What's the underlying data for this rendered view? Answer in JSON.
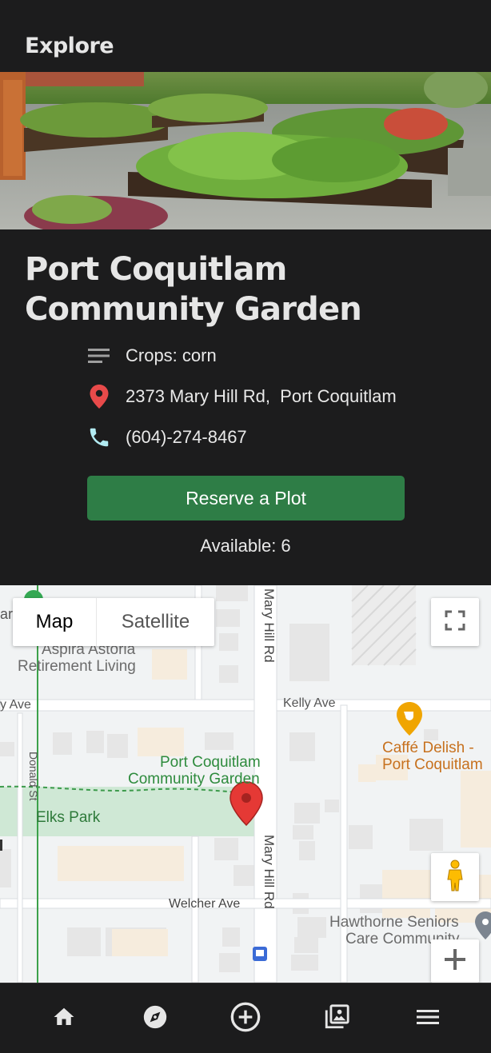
{
  "header": {
    "title": "Explore"
  },
  "garden": {
    "name": "Port Coquitlam Community Garden",
    "crops": "Crops: corn",
    "address": "2373 Mary Hill Rd,  Port Coquitlam",
    "phone": "(604)-274-8467",
    "reserve_label": "Reserve a Plot",
    "available": "Available: 6"
  },
  "map": {
    "type_map": "Map",
    "type_satellite": "Satellite",
    "labels": {
      "aspira": "Aspira Astoria",
      "retirement": "Retirement Living",
      "ar": "ar",
      "kelly_left": "y Ave",
      "kelly_right": "Kelly Ave",
      "donald": "Donald St",
      "mary_hill_top": "Mary Hill Rd",
      "mary_hill_bottom": "Mary Hill Rd",
      "cafe1": "Caffé Delish -",
      "cafe2": "Port Coquitlam",
      "garden1": "Port Coquitlam",
      "garden2": "Community Garden",
      "elks": "Elks Park",
      "welcher": "Welcher Ave",
      "hawthorne1": "Hawthorne Seniors",
      "hawthorne2": "Care Community"
    }
  },
  "icons": {
    "crops": "notes-icon",
    "address": "location-pin-icon",
    "phone": "phone-icon",
    "fullscreen": "fullscreen-icon",
    "pegman": "street-view-pegman-icon",
    "zoom_in": "plus-icon"
  },
  "colors": {
    "background": "#1c1c1d",
    "reserve_button": "#2e7d46",
    "pin": "#e53935",
    "phone_icon": "#b2ebf2",
    "park": "#cfe8d5"
  },
  "nav": [
    "home-icon",
    "explore-compass-icon",
    "add-circle-icon",
    "gallery-icon",
    "menu-icon"
  ]
}
